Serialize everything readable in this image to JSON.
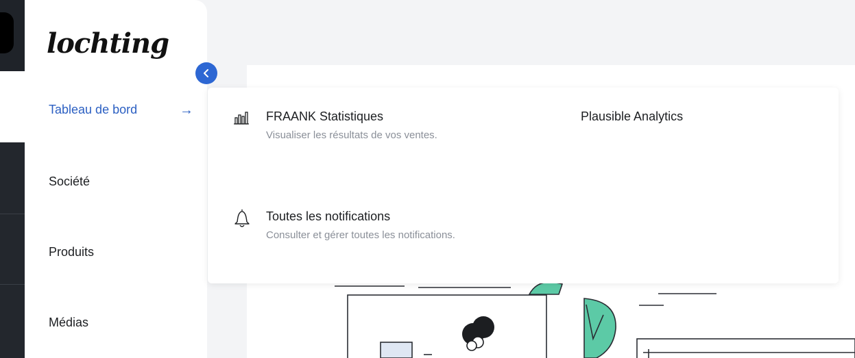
{
  "sidebar": {
    "logo": "lochting",
    "items": [
      {
        "label": "Tableau de bord",
        "active": true
      },
      {
        "label": "Société"
      },
      {
        "label": "Produits"
      },
      {
        "label": "Médias"
      }
    ],
    "active_arrow": "→",
    "collapse_icon": "chevron-left-icon"
  },
  "menu": {
    "entries": [
      {
        "title": "FRAANK Statistiques",
        "description": "Visualiser les résultats de vos ventes.",
        "icon": "bar-chart-icon"
      },
      {
        "title": "Plausible Analytics",
        "description": ""
      },
      {
        "title": "Toutes les notifications",
        "description": "Consulter et gérer toutes les notifications.",
        "icon": "bell-icon"
      }
    ]
  },
  "colors": {
    "accent": "#2b5fc2",
    "collapse_button": "#2d67d3",
    "illustration_green": "#5ccaa6",
    "rail": "#23272d"
  }
}
